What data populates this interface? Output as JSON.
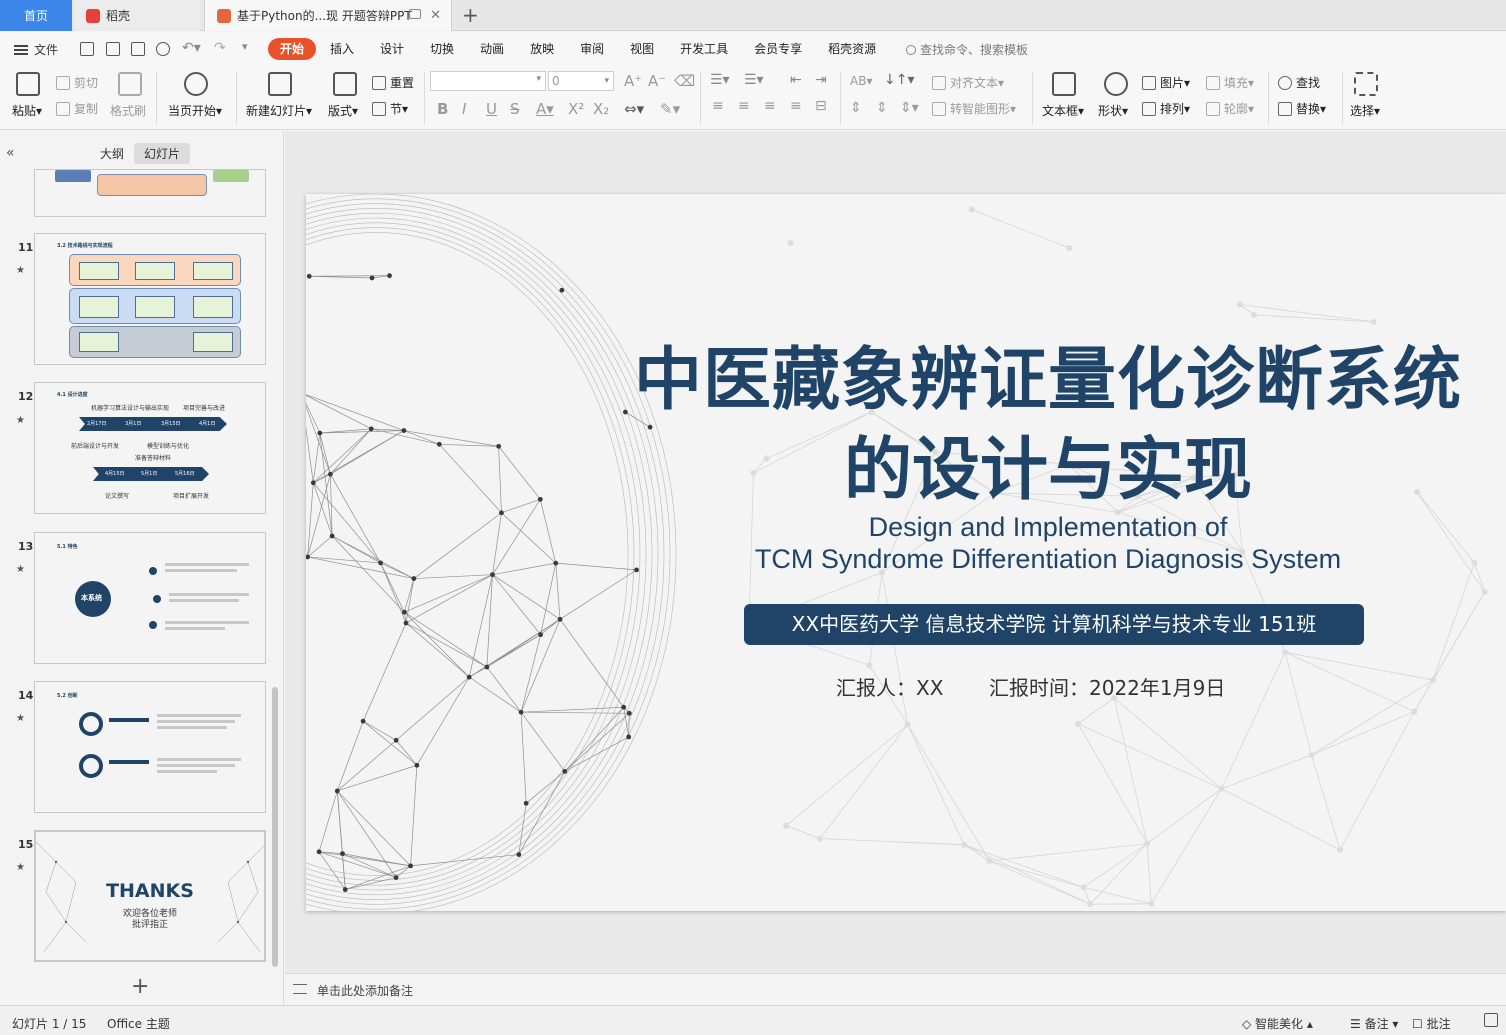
{
  "tabs": {
    "home": "首页",
    "draft": "稻壳",
    "document": "基于Python的...现 开题答辩PPT"
  },
  "menu": {
    "file": "文件",
    "tabs": [
      "开始",
      "插入",
      "设计",
      "切换",
      "动画",
      "放映",
      "审阅",
      "视图",
      "开发工具",
      "会员专享",
      "稻壳资源"
    ],
    "active_tab": "开始",
    "search_placeholder": "查找命令、搜索模板"
  },
  "ribbon": {
    "paste": "粘贴",
    "cut": "剪切",
    "copy": "复制",
    "format_painter": "格式刷",
    "from_current": "当页开始",
    "new_slide": "新建幻灯片",
    "layout": "版式",
    "reset": "重置",
    "section": "节",
    "font_size_value": "0",
    "align_text": "对齐文本",
    "smart_art": "转智能图形",
    "textbox": "文本框",
    "shape": "形状",
    "picture": "图片",
    "arrange": "排列",
    "fill": "填充",
    "outline": "轮廓",
    "find": "查找",
    "replace": "替换",
    "select": "选择"
  },
  "panel": {
    "outline_tab": "大纲",
    "slides_tab": "幻灯片",
    "thumbnails": [
      {
        "num": "11",
        "title": "3.2 技术路线与实现流程"
      },
      {
        "num": "12",
        "title": "4.1 设计进度",
        "labels": [
          "机器学习算法设计与输出实现",
          "项目完善与改进",
          "前后端设计与开发",
          "模型训练与优化",
          "准备答辩材料",
          "论文撰写",
          "项目扩展开发"
        ],
        "dates": [
          "2月17日",
          "3月1日",
          "3月15日",
          "4月1日",
          "4月15日",
          "5月1日",
          "5月16日"
        ]
      },
      {
        "num": "13",
        "title": "5.1 特色",
        "center": "本系统"
      },
      {
        "num": "14",
        "title": "5.2 创新"
      },
      {
        "num": "15",
        "title": "THANKS",
        "line1": "欢迎各位老师",
        "line2": "批评指正"
      }
    ]
  },
  "slide": {
    "title_line1": "中医藏象辨证量化诊断系统",
    "title_line2": "的设计与实现",
    "subtitle_line1": "Design and Implementation of",
    "subtitle_line2": "TCM Syndrome Differentiation Diagnosis System",
    "banner": "XX中医药大学  信息技术学院   计算机科学与技术专业  151班",
    "reporter": "汇报人：XX",
    "report_date": "汇报时间：2022年1月9日"
  },
  "notes": {
    "placeholder": "单击此处添加备注"
  },
  "status": {
    "slide_counter": "幻灯片 1 / 15",
    "theme": "Office 主题",
    "beautify": "智能美化",
    "notes_btn": "备注",
    "comment_btn": "批注"
  },
  "colors": {
    "accent": "#e8522b",
    "home_tab": "#3b86e8",
    "title_navy": "#1f4468"
  }
}
